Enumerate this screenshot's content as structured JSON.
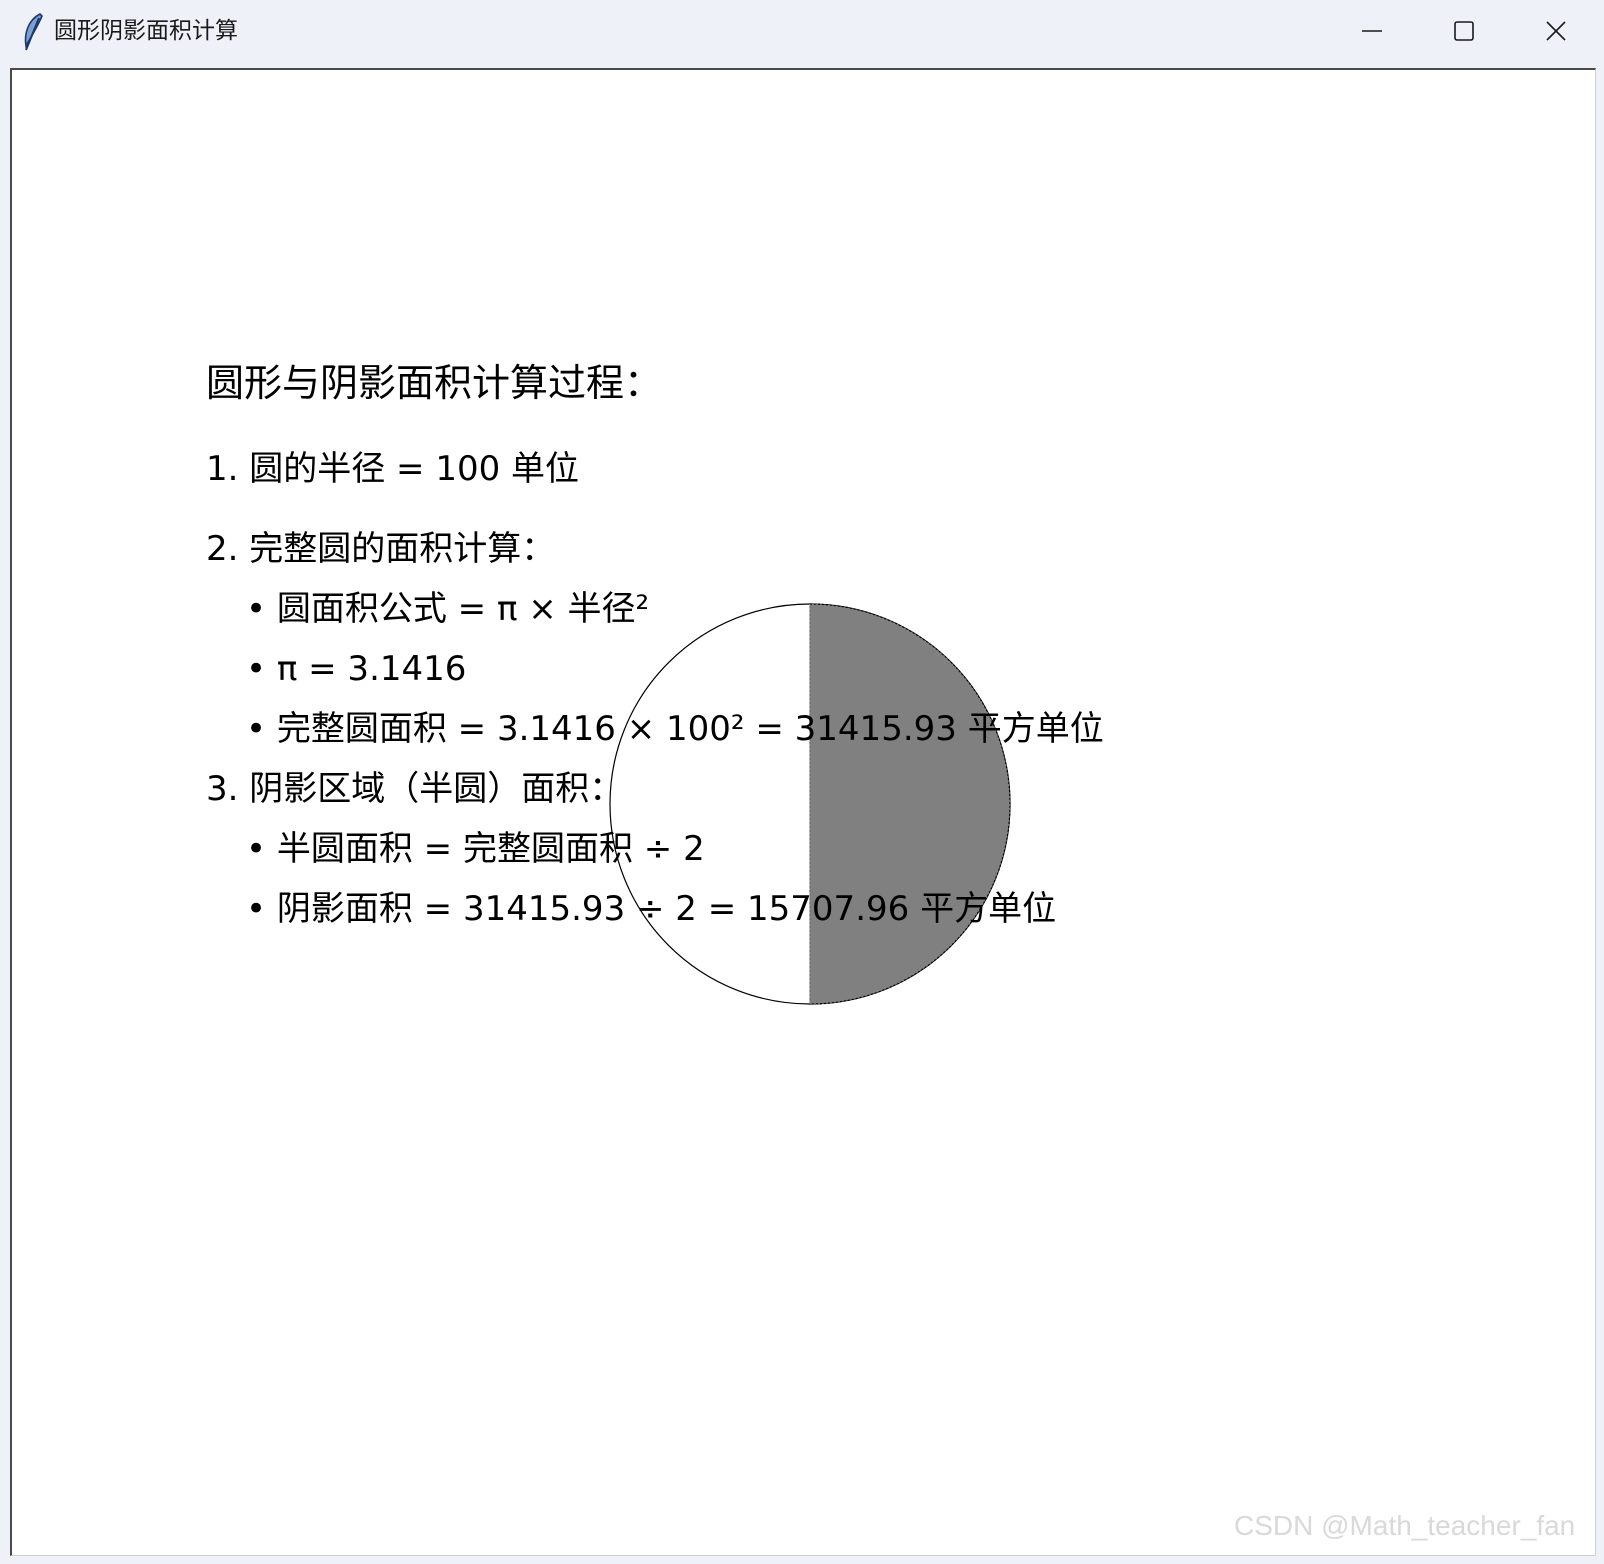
{
  "window": {
    "title": "圆形阴影面积计算",
    "icon": "feather-icon",
    "controls": [
      "minimize-icon",
      "maximize-icon",
      "close-icon"
    ]
  },
  "colors": {
    "titlebar": "#eef2f8",
    "canvas_bg": "#ffffff",
    "shaded_fill": "#808080",
    "outline": "#000000",
    "watermark": "#d9d9d9"
  },
  "content": {
    "heading": "圆形与阴影面积计算过程：",
    "step1": "1. 圆的半径 = 100 单位",
    "step2": "2. 完整圆的面积计算：",
    "step2_formula": "• 圆面积公式 = π × 半径²",
    "step2_pi": "• π = 3.1416",
    "step2_area": "• 完整圆面积 = 3.1416 × 100² = 31415.93 平方单位",
    "step3": "3. 阴影区域（半圆）面积：",
    "step3_formula": "• 半圆面积 = 完整圆面积 ÷ 2",
    "step3_area": "• 阴影面积 = 31415.93 ÷ 2 = 15707.96 平方单位"
  },
  "figure": {
    "shape": "circle",
    "shaded_part": "right-half"
  },
  "watermark": "CSDN @Math_teacher_fan"
}
